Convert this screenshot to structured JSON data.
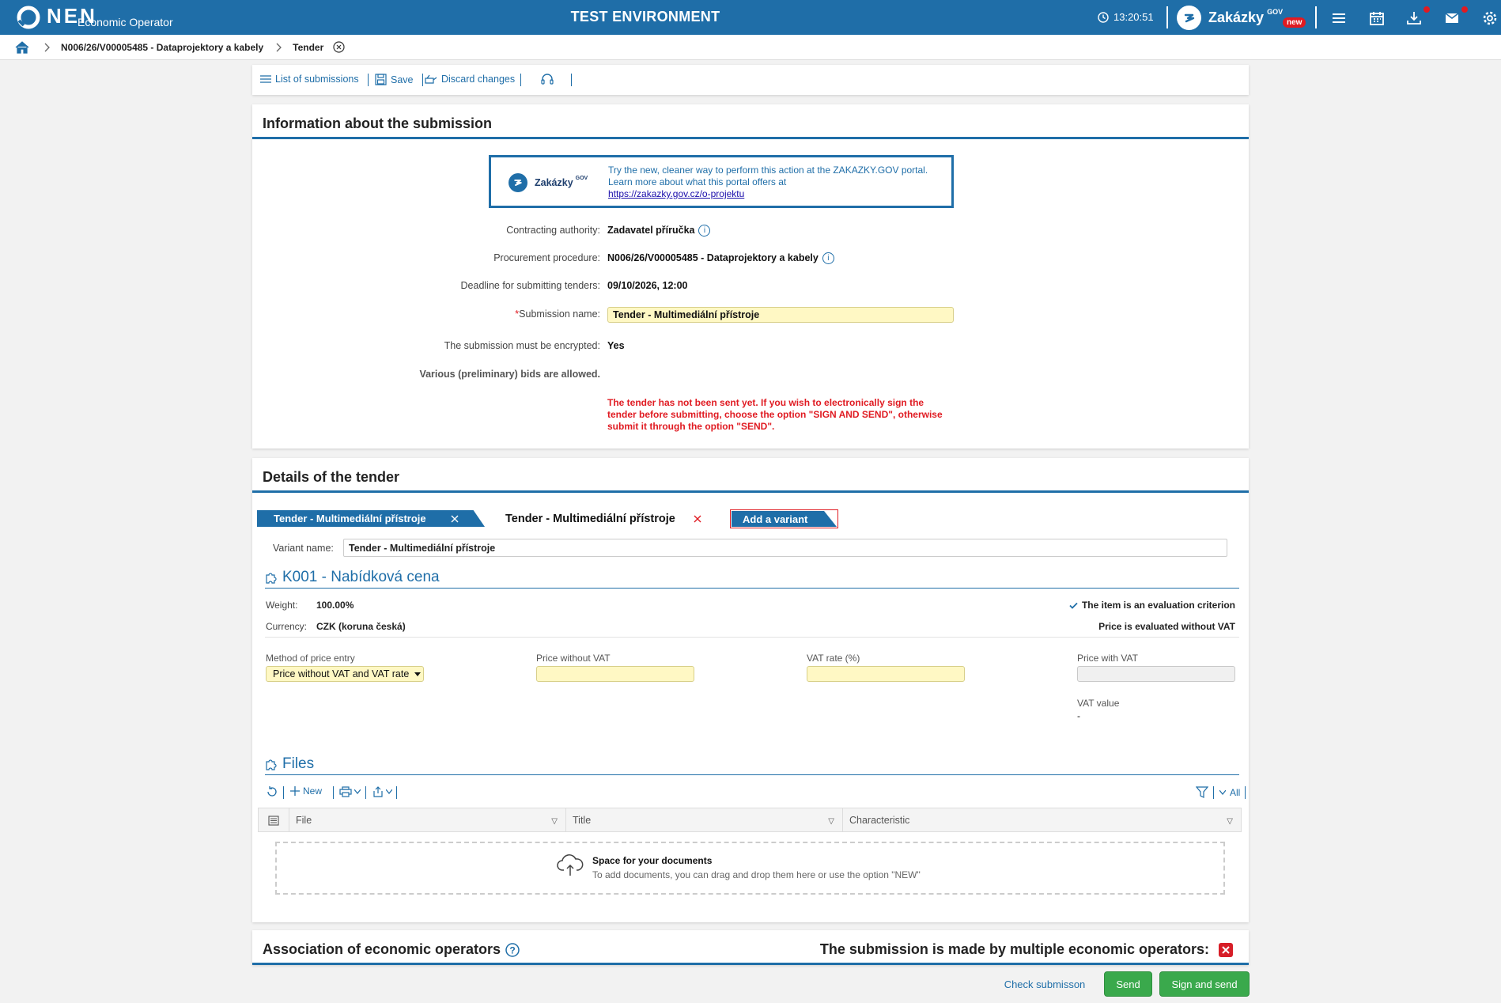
{
  "header": {
    "logo_text": "NEN",
    "logo_sub": "Economic Operator",
    "environment": "TEST ENVIRONMENT",
    "clock": "13:20:51",
    "zakazky_name": "Zakázky",
    "zakazky_sup": "GOV",
    "zakazky_badge": "new",
    "icons": [
      "menu-icon",
      "calendar-icon",
      "download-icon",
      "mail-icon",
      "settings-icon"
    ]
  },
  "breadcrumb": {
    "procedure": "N006/26/V00005485 - Dataprojektory a kabely",
    "current": "Tender"
  },
  "toolbar": {
    "list": "List of submissions",
    "save": "Save",
    "discard": "Discard changes"
  },
  "info": {
    "title": "Information about the submission",
    "banner": {
      "logo": "Zakázky",
      "logo_sup": "GOV",
      "line1": "Try the new, cleaner way to perform this action at the ZAKAZKY.GOV portal.",
      "line2": "Learn more about what this portal offers at",
      "link": "https://zakazky.gov.cz/o-projektu"
    },
    "fields": {
      "authority_label": "Contracting authority:",
      "authority": "Zadavatel příručka",
      "procedure_label": "Procurement procedure:",
      "procedure": "N006/26/V00005485 - Dataprojektory a kabely",
      "deadline_label": "Deadline for submitting tenders:",
      "deadline": "09/10/2026, 12:00",
      "name_label": "Submission name:",
      "name_required": "*",
      "name": "Tender - Multimediální přístroje",
      "encrypted_label": "The submission must be encrypted:",
      "encrypted": "Yes",
      "various": "Various (preliminary) bids are allowed."
    },
    "warning": "The tender has not been sent yet. If you wish to electronically sign the tender before submitting, choose the option \"SIGN AND SEND\", otherwise submit it through the option \"SEND\"."
  },
  "details": {
    "title": "Details of the tender",
    "tabs": [
      "Tender - Multimediální přístroje",
      "Tender - Multimediální přístroje"
    ],
    "add_variant": "Add a variant",
    "variant_label": "Variant name:",
    "variant_value": "Tender - Multimediální přístroje",
    "criterion": {
      "title": "K001 - Nabídková cena",
      "weight_label": "Weight:",
      "weight": "100.00%",
      "currency_label": "Currency:",
      "currency": "CZK (koruna česká)",
      "eval_criterion": "The item is an evaluation criterion",
      "eval_vat": "Price is evaluated without VAT",
      "method_label": "Method of price entry",
      "method_value": "Price without VAT and VAT rate",
      "price_wo_label": "Price without VAT",
      "vat_rate_label": "VAT rate (%)",
      "price_w_label": "Price with VAT",
      "vat_value_label": "VAT value",
      "vat_value": "-"
    },
    "files": {
      "title": "Files",
      "new": "New",
      "all": "All",
      "columns": [
        "File",
        "Title",
        "Characteristic"
      ],
      "drop_title": "Space for your documents",
      "drop_hint": "To add documents, you can drag and drop them here or use the option \"NEW\""
    }
  },
  "association": {
    "title": "Association of economic operators",
    "multiple": "The submission is made by multiple economic operators:"
  },
  "actions": {
    "check": "Check submisson",
    "send": "Send",
    "sign_send": "Sign and send"
  },
  "colors": {
    "brand": "#1f6ea8",
    "field": "#fff8c4",
    "warning": "#e01b22",
    "green": "#3aa94c"
  }
}
